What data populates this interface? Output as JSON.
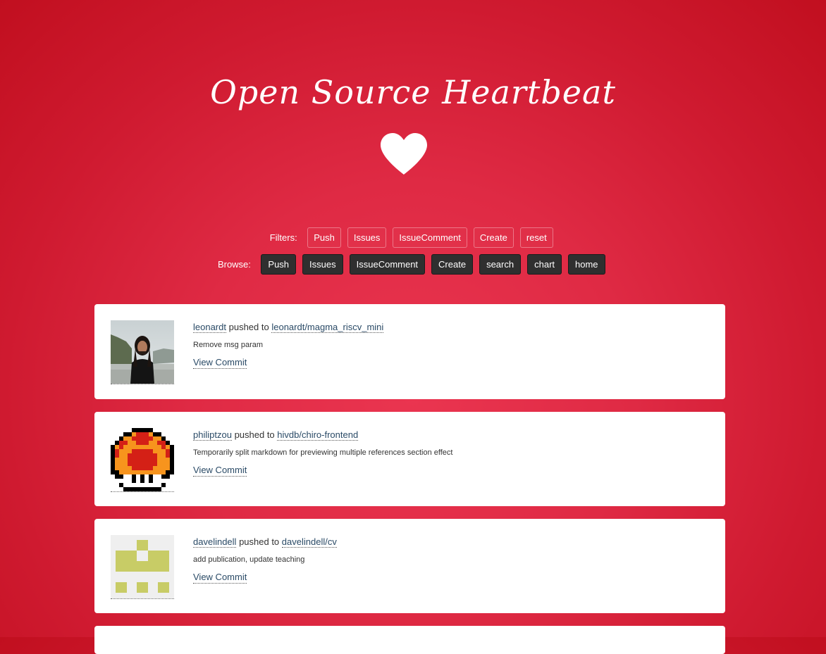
{
  "header": {
    "title": "Open Source Heartbeat",
    "heart_icon": "heart-icon"
  },
  "filters": {
    "label": "Filters:",
    "buttons": [
      "Push",
      "Issues",
      "IssueComment",
      "Create",
      "reset"
    ]
  },
  "browse": {
    "label": "Browse:",
    "buttons": [
      "Push",
      "Issues",
      "IssueComment",
      "Create",
      "search",
      "chart",
      "home"
    ]
  },
  "events": [
    {
      "user": "leonardt",
      "action": "pushed to",
      "repo": "leonardt/magma_riscv_mini",
      "message": "Remove msg param",
      "link_label": "View Commit",
      "avatar": "photo-avatar"
    },
    {
      "user": "philiptzou",
      "action": "pushed to",
      "repo": "hivdb/chiro-frontend",
      "message": "Temporarily split markdown for previewing multiple references section effect",
      "link_label": "View Commit",
      "avatar": "pixel-mushroom-avatar"
    },
    {
      "user": "davelindell",
      "action": "pushed to",
      "repo": "davelindell/cv",
      "message": "add publication, update teaching",
      "link_label": "View Commit",
      "avatar": "identicon-avatar"
    }
  ],
  "colors": {
    "background": "#e02a44",
    "button_dark": "#2f2f2f",
    "link": "#2a4a66",
    "identicon": "#c8cc66"
  }
}
